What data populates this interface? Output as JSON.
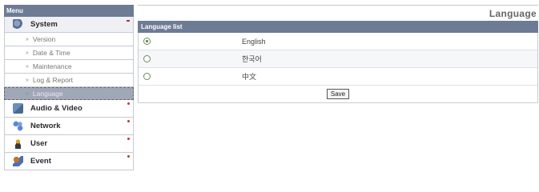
{
  "sidebar": {
    "header": "Menu",
    "system": {
      "label": "System",
      "icon": "system-icon",
      "items": [
        {
          "label": "Version"
        },
        {
          "label": "Date & Time"
        },
        {
          "label": "Maintenance"
        },
        {
          "label": "Log & Report"
        },
        {
          "label": "Language",
          "active": true
        }
      ]
    },
    "categories": [
      {
        "label": "Audio & Video",
        "icon": "audio-video-icon"
      },
      {
        "label": "Network",
        "icon": "network-icon"
      },
      {
        "label": "User",
        "icon": "user-icon"
      },
      {
        "label": "Event",
        "icon": "event-icon"
      }
    ]
  },
  "main": {
    "title": "Language",
    "list_header": "Language list",
    "languages": [
      {
        "label": "English",
        "selected": true
      },
      {
        "label": "한국어",
        "selected": false
      },
      {
        "label": "中文",
        "selected": false
      }
    ],
    "save_label": "Save"
  },
  "colors": {
    "header_bg": "#6d7b95",
    "active_item_bg": "#a0a8b8",
    "accent_dot": "#c0392b"
  }
}
